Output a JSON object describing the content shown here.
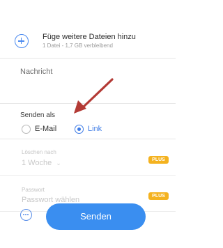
{
  "upload": {
    "title": "Füge weitere Dateien hinzu",
    "subtitle": "1 Datei - 1,7 GB verbleibend",
    "icon": "add-circle-icon"
  },
  "message": {
    "placeholder": "Nachricht"
  },
  "send_as": {
    "label": "Senden als",
    "options": [
      "E-Mail",
      "Link"
    ],
    "selected": "Link"
  },
  "delete_after": {
    "label": "Löschen nach",
    "value": "1 Woche",
    "badge": "PLUS"
  },
  "password": {
    "label": "Passwort",
    "placeholder": "Passwort wählen",
    "badge": "PLUS"
  },
  "actions": {
    "more_icon": "more-options-icon",
    "send_label": "Senden"
  },
  "colors": {
    "accent": "#3a8ef0",
    "badge": "#f4b21f",
    "annotation_arrow": "#b33a35"
  }
}
